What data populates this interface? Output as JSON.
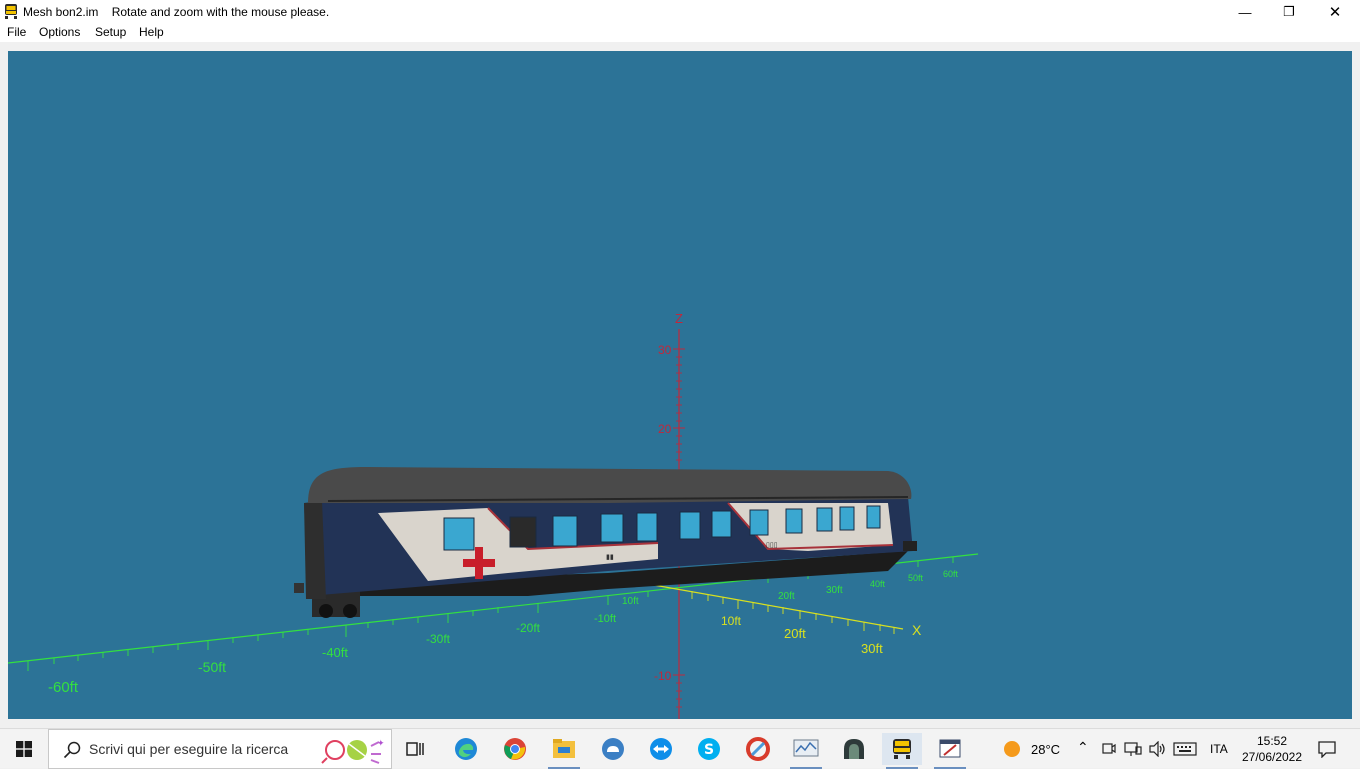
{
  "window": {
    "app_name": "Mesh bon2.im",
    "message": "Rotate and zoom with the mouse please.",
    "controls": {
      "minimize": "—",
      "restore": "❐",
      "close": "✕"
    }
  },
  "menu": {
    "items": [
      "File",
      "Options",
      "Setup",
      "Help"
    ]
  },
  "viewport": {
    "background": "#2c7397",
    "axes": {
      "z_label": "Z",
      "x_label": "X",
      "z_ticks": [
        "30",
        "20",
        "-10"
      ],
      "x_ticks": [
        "10ft",
        "20ft",
        "30ft"
      ],
      "y_ticks": [
        "-60ft",
        "-50ft",
        "-40ft",
        "-30ft",
        "-20ft",
        "-10ft",
        "10ft",
        "20ft",
        "30ft",
        "40ft",
        "50ft",
        "60ft"
      ],
      "z_color": "#c0283c",
      "ground_color": "#33e040",
      "x_color": "#d8e020"
    },
    "model": {
      "roof_color": "#4a4a4a",
      "body_color": "#223356",
      "livery_color": "#d9d4cc",
      "cross_color": "#c81e2a",
      "window_color": "#3aa7d0"
    }
  },
  "taskbar": {
    "search_placeholder": "Scrivi qui per eseguire la ricerca",
    "apps": [
      "task-view",
      "edge",
      "chrome",
      "file-explorer",
      "app-blue",
      "teamviewer",
      "skype",
      "app-ccleaner",
      "app-monitor",
      "app-dark",
      "app-train",
      "app-editor"
    ],
    "weather_temp": "28°C",
    "language": "ITA",
    "time": "15:52",
    "date": "27/06/2022"
  }
}
